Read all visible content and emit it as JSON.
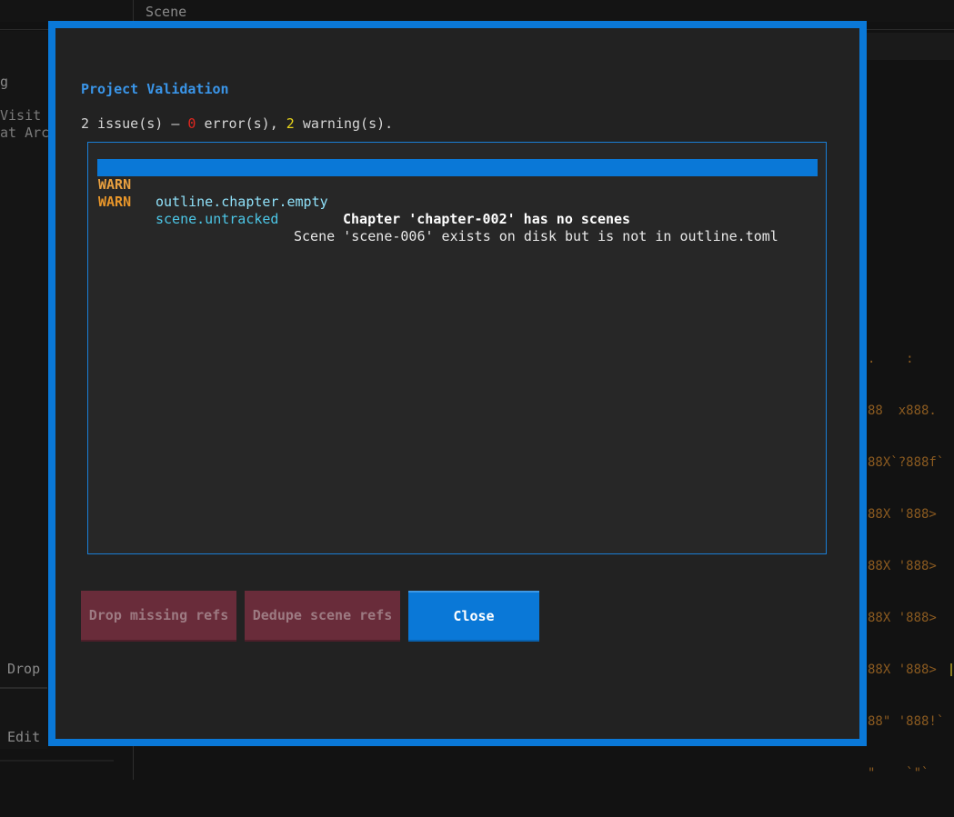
{
  "background": {
    "top_label": "Scene",
    "left_labels": [
      "g",
      "Visit",
      "at Arc",
      "Drop",
      "Edit"
    ],
    "ascii_art": [
      ".    :",
      "88  x888.",
      "88X`?888f`",
      "88X '888>",
      "88X '888>",
      "88X '888>",
      "88X '888>",
      "88\" '888!`",
      "\"    `\"`"
    ]
  },
  "dialog": {
    "title": "Project Validation",
    "summary": {
      "prefix": "2 issue(s) — ",
      "errors": "0",
      "errors_suffix": " error(s), ",
      "warnings": "2",
      "warnings_suffix": " warning(s)."
    },
    "issues": [
      {
        "level": "WARN",
        "code": "outline.chapter.empty",
        "message": "Chapter 'chapter-002' has no scenes",
        "selected": true
      },
      {
        "level": "WARN",
        "code": "scene.untracked",
        "message": "Scene 'scene-006' exists on disk but is not in outline.toml",
        "selected": false
      }
    ],
    "buttons": {
      "drop_missing": "Drop missing refs",
      "dedupe_scene": "Dedupe scene refs",
      "close": "Close"
    }
  },
  "colors": {
    "accent": "#0a78d7",
    "warn_level": "#e8962a",
    "code": "#4cc6e6",
    "error_count": "#e0261f",
    "warning_count": "#e8d41a",
    "disabled_button": "#692c3a"
  }
}
